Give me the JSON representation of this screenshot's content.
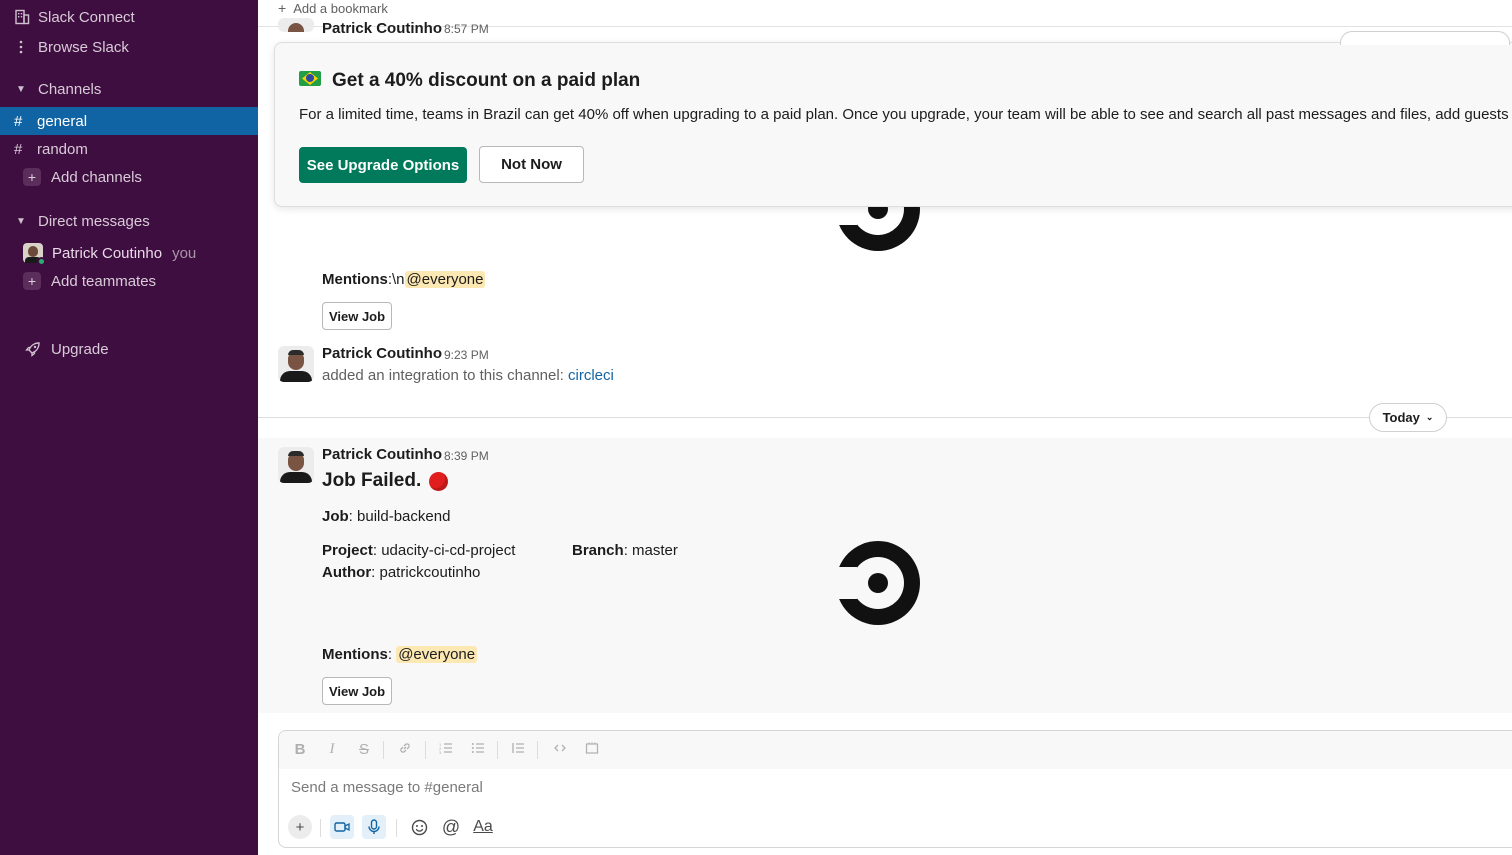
{
  "sidebar": {
    "slack_connect": "Slack Connect",
    "browse_slack": "Browse Slack",
    "channels_header": "Channels",
    "channels": [
      {
        "hash": "#",
        "name": "general"
      },
      {
        "hash": "#",
        "name": "random"
      }
    ],
    "add_channels": "Add channels",
    "dm_header": "Direct messages",
    "dm_user": "Patrick Coutinho",
    "dm_you": "you",
    "add_teammates": "Add teammates",
    "upgrade": "Upgrade"
  },
  "bookmarks": {
    "add_label": "Add a bookmark"
  },
  "promo": {
    "title": "Get a 40% discount on a paid plan",
    "body": "For a limited time, teams in Brazil can get 40% off when upgrading to a paid plan. Once you upgrade, your team will be able to see and search all past messages and files, add guests to yo",
    "primary_button": "See Upgrade Options",
    "secondary_button": "Not Now"
  },
  "messages": {
    "top": {
      "author": "Patrick Coutinho",
      "time": "8:57 PM"
    },
    "mentions_1": {
      "label": "Mentions",
      "sep": ":\\n",
      "mention": "@everyone"
    },
    "view_job_1": "View Job",
    "integration": {
      "author": "Patrick Coutinho",
      "time": "9:23 PM",
      "text": "added an integration to this channel: ",
      "link": "circleci"
    },
    "today_label": "Today",
    "failed": {
      "author": "Patrick Coutinho",
      "time": "8:39 PM",
      "title": "Job Failed.",
      "job_label": "Job",
      "job_value": ": build-backend",
      "project_label": "Project",
      "project_value": ": udacity-ci-cd-project",
      "branch_label": "Branch",
      "branch_value": ": master",
      "author_label": "Author",
      "author_value": ": patrickcoutinho",
      "mentions_label": "Mentions",
      "mentions_sep": ": ",
      "mention": "@everyone",
      "view_job": "View Job"
    }
  },
  "composer": {
    "placeholder": "Send a message to #general",
    "format_icons": [
      "B",
      "I",
      "S"
    ],
    "aa": "Aa"
  },
  "colors": {
    "sidebar_bg": "#3f0e40",
    "active_channel": "#1164a3",
    "primary_button": "#007a5a",
    "mention_bg": "#fce8b2",
    "link": "#1264a3",
    "status_error": "#e01e1e"
  }
}
